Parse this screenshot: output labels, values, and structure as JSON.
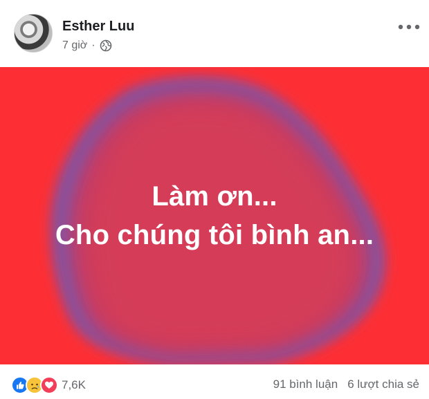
{
  "post": {
    "author": "Esther Luu",
    "time": "7 giờ",
    "separator": "·",
    "privacy_icon": "globe-icon",
    "more_icon": "more-horizontal-icon",
    "text_lines": [
      "Làm ơn...",
      "Cho chúng tôi bình an..."
    ],
    "background_color": "#fd2f34",
    "blob_color": "#7c55a8"
  },
  "footer": {
    "reaction_icons": [
      "like-icon",
      "sad-icon",
      "love-icon"
    ],
    "reaction_count": "7,6K",
    "comments": "91 bình luận",
    "shares": "6 lượt chia sẻ"
  }
}
